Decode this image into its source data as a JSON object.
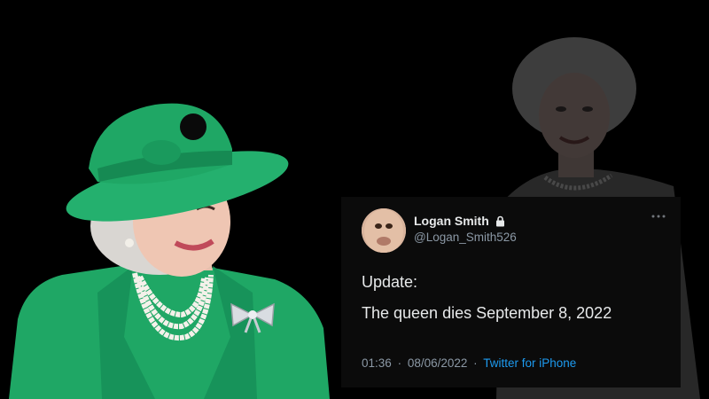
{
  "tweet": {
    "display_name": "Logan Smith",
    "handle": "@Logan_Smith526",
    "protected_icon": "lock-icon",
    "more_icon": "more-horizontal-icon",
    "lines": [
      "Update:",
      "The queen dies September 8, 2022"
    ],
    "time": "01:36",
    "date": "08/06/2022",
    "separator": "·",
    "source": "Twitter for iPhone",
    "source_color": "#1d9bf0"
  },
  "colors": {
    "background": "#000000",
    "coat_green": "#1fa765",
    "hat_green": "#24b06e",
    "card_background": "#0b0b0b",
    "text_primary": "#e7e9ea",
    "text_secondary": "#8b98a5"
  }
}
